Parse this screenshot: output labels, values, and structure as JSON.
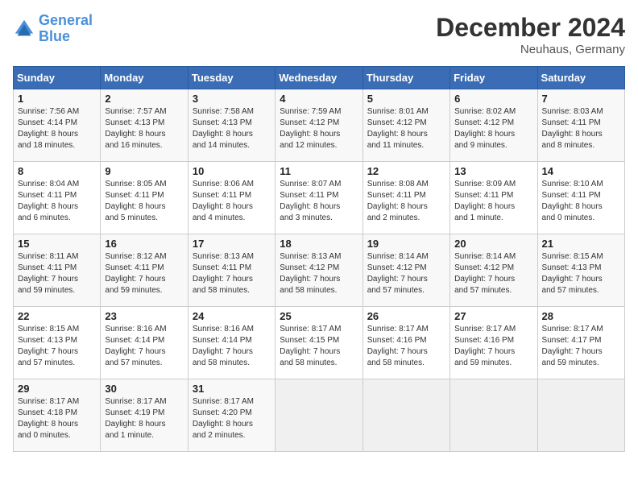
{
  "logo": {
    "line1": "General",
    "line2": "Blue"
  },
  "title": "December 2024",
  "location": "Neuhaus, Germany",
  "days_of_week": [
    "Sunday",
    "Monday",
    "Tuesday",
    "Wednesday",
    "Thursday",
    "Friday",
    "Saturday"
  ],
  "weeks": [
    [
      {
        "day": "1",
        "detail": "Sunrise: 7:56 AM\nSunset: 4:14 PM\nDaylight: 8 hours\nand 18 minutes."
      },
      {
        "day": "2",
        "detail": "Sunrise: 7:57 AM\nSunset: 4:13 PM\nDaylight: 8 hours\nand 16 minutes."
      },
      {
        "day": "3",
        "detail": "Sunrise: 7:58 AM\nSunset: 4:13 PM\nDaylight: 8 hours\nand 14 minutes."
      },
      {
        "day": "4",
        "detail": "Sunrise: 7:59 AM\nSunset: 4:12 PM\nDaylight: 8 hours\nand 12 minutes."
      },
      {
        "day": "5",
        "detail": "Sunrise: 8:01 AM\nSunset: 4:12 PM\nDaylight: 8 hours\nand 11 minutes."
      },
      {
        "day": "6",
        "detail": "Sunrise: 8:02 AM\nSunset: 4:12 PM\nDaylight: 8 hours\nand 9 minutes."
      },
      {
        "day": "7",
        "detail": "Sunrise: 8:03 AM\nSunset: 4:11 PM\nDaylight: 8 hours\nand 8 minutes."
      }
    ],
    [
      {
        "day": "8",
        "detail": "Sunrise: 8:04 AM\nSunset: 4:11 PM\nDaylight: 8 hours\nand 6 minutes."
      },
      {
        "day": "9",
        "detail": "Sunrise: 8:05 AM\nSunset: 4:11 PM\nDaylight: 8 hours\nand 5 minutes."
      },
      {
        "day": "10",
        "detail": "Sunrise: 8:06 AM\nSunset: 4:11 PM\nDaylight: 8 hours\nand 4 minutes."
      },
      {
        "day": "11",
        "detail": "Sunrise: 8:07 AM\nSunset: 4:11 PM\nDaylight: 8 hours\nand 3 minutes."
      },
      {
        "day": "12",
        "detail": "Sunrise: 8:08 AM\nSunset: 4:11 PM\nDaylight: 8 hours\nand 2 minutes."
      },
      {
        "day": "13",
        "detail": "Sunrise: 8:09 AM\nSunset: 4:11 PM\nDaylight: 8 hours\nand 1 minute."
      },
      {
        "day": "14",
        "detail": "Sunrise: 8:10 AM\nSunset: 4:11 PM\nDaylight: 8 hours\nand 0 minutes."
      }
    ],
    [
      {
        "day": "15",
        "detail": "Sunrise: 8:11 AM\nSunset: 4:11 PM\nDaylight: 7 hours\nand 59 minutes."
      },
      {
        "day": "16",
        "detail": "Sunrise: 8:12 AM\nSunset: 4:11 PM\nDaylight: 7 hours\nand 59 minutes."
      },
      {
        "day": "17",
        "detail": "Sunrise: 8:13 AM\nSunset: 4:11 PM\nDaylight: 7 hours\nand 58 minutes."
      },
      {
        "day": "18",
        "detail": "Sunrise: 8:13 AM\nSunset: 4:12 PM\nDaylight: 7 hours\nand 58 minutes."
      },
      {
        "day": "19",
        "detail": "Sunrise: 8:14 AM\nSunset: 4:12 PM\nDaylight: 7 hours\nand 57 minutes."
      },
      {
        "day": "20",
        "detail": "Sunrise: 8:14 AM\nSunset: 4:12 PM\nDaylight: 7 hours\nand 57 minutes."
      },
      {
        "day": "21",
        "detail": "Sunrise: 8:15 AM\nSunset: 4:13 PM\nDaylight: 7 hours\nand 57 minutes."
      }
    ],
    [
      {
        "day": "22",
        "detail": "Sunrise: 8:15 AM\nSunset: 4:13 PM\nDaylight: 7 hours\nand 57 minutes."
      },
      {
        "day": "23",
        "detail": "Sunrise: 8:16 AM\nSunset: 4:14 PM\nDaylight: 7 hours\nand 57 minutes."
      },
      {
        "day": "24",
        "detail": "Sunrise: 8:16 AM\nSunset: 4:14 PM\nDaylight: 7 hours\nand 58 minutes."
      },
      {
        "day": "25",
        "detail": "Sunrise: 8:17 AM\nSunset: 4:15 PM\nDaylight: 7 hours\nand 58 minutes."
      },
      {
        "day": "26",
        "detail": "Sunrise: 8:17 AM\nSunset: 4:16 PM\nDaylight: 7 hours\nand 58 minutes."
      },
      {
        "day": "27",
        "detail": "Sunrise: 8:17 AM\nSunset: 4:16 PM\nDaylight: 7 hours\nand 59 minutes."
      },
      {
        "day": "28",
        "detail": "Sunrise: 8:17 AM\nSunset: 4:17 PM\nDaylight: 7 hours\nand 59 minutes."
      }
    ],
    [
      {
        "day": "29",
        "detail": "Sunrise: 8:17 AM\nSunset: 4:18 PM\nDaylight: 8 hours\nand 0 minutes."
      },
      {
        "day": "30",
        "detail": "Sunrise: 8:17 AM\nSunset: 4:19 PM\nDaylight: 8 hours\nand 1 minute."
      },
      {
        "day": "31",
        "detail": "Sunrise: 8:17 AM\nSunset: 4:20 PM\nDaylight: 8 hours\nand 2 minutes."
      },
      {
        "day": "",
        "detail": ""
      },
      {
        "day": "",
        "detail": ""
      },
      {
        "day": "",
        "detail": ""
      },
      {
        "day": "",
        "detail": ""
      }
    ]
  ]
}
